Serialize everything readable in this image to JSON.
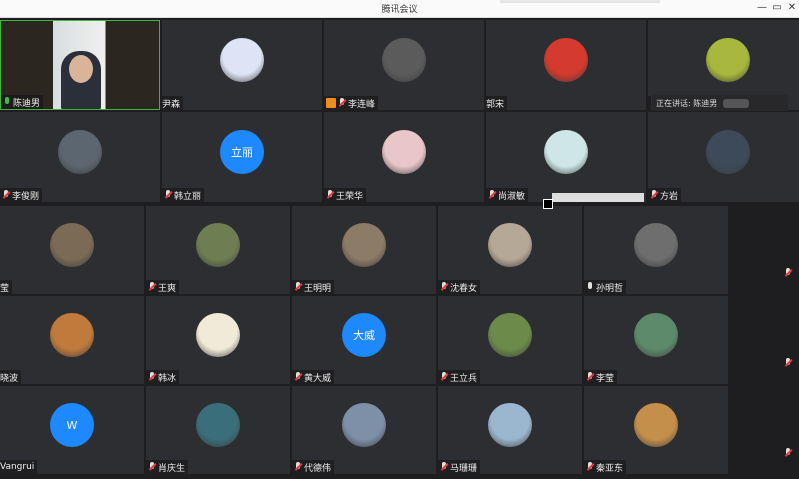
{
  "window": {
    "title": "腾讯会议",
    "controls": {
      "minimize": "—",
      "restore": "▭",
      "close": "✕"
    }
  },
  "speaking_indicator": {
    "label": "正在讲话: 陈迪男"
  },
  "participants_top": [
    {
      "name": "陈迪男",
      "mic": "on",
      "avatar": "video",
      "color": "#c8c4bc"
    },
    {
      "name": "尹森",
      "mic": "none",
      "avatar": "photo",
      "color": "#dde4f5"
    },
    {
      "name": "李连峰",
      "mic": "off",
      "avatar": "photo",
      "color": "#5b5b5b",
      "sharing": true
    },
    {
      "name": "郭宋",
      "mic": "none",
      "avatar": "photo",
      "color": "#d53a2f"
    },
    {
      "name": "",
      "mic": "none",
      "avatar": "photo",
      "color": "#a8b83c"
    },
    {
      "name": "李俊刚",
      "mic": "off",
      "avatar": "photo",
      "color": "#5c6670"
    },
    {
      "name": "韩立丽",
      "mic": "off",
      "avatar": "text",
      "avatar_text": "立丽",
      "color": "#1e88ff"
    },
    {
      "name": "王荣华",
      "mic": "off",
      "avatar": "photo",
      "color": "#e9c6c8"
    },
    {
      "name": "尚淑敏",
      "mic": "off",
      "avatar": "photo",
      "color": "#cfe6e6"
    },
    {
      "name": "方岩",
      "mic": "off",
      "avatar": "photo",
      "color": "#3d4a5a"
    }
  ],
  "participants_bottom": [
    {
      "name": "莹",
      "mic": "none",
      "avatar": "photo",
      "color": "#7b6a55"
    },
    {
      "name": "王爽",
      "mic": "off",
      "avatar": "photo",
      "color": "#6f7e52"
    },
    {
      "name": "王明明",
      "mic": "off",
      "avatar": "photo",
      "color": "#8c7b66"
    },
    {
      "name": "沈春女",
      "mic": "off",
      "avatar": "photo",
      "color": "#b6a897"
    },
    {
      "name": "孙明哲",
      "mic": "on_gray",
      "avatar": "photo",
      "color": "#6e6e6e"
    },
    {
      "name": "晓波",
      "mic": "none",
      "avatar": "photo",
      "color": "#c07a3c"
    },
    {
      "name": "韩冰",
      "mic": "off",
      "avatar": "photo",
      "color": "#f1ead8"
    },
    {
      "name": "黄大威",
      "mic": "off",
      "avatar": "text",
      "avatar_text": "大威",
      "color": "#1e88ff"
    },
    {
      "name": "王立兵",
      "mic": "off",
      "avatar": "photo",
      "color": "#6c8a4a"
    },
    {
      "name": "李莹",
      "mic": "off",
      "avatar": "photo",
      "color": "#5d8a6a"
    },
    {
      "name": "Vangrui",
      "mic": "none",
      "avatar": "text",
      "avatar_text": "W",
      "color": "#1e88ff"
    },
    {
      "name": "肖庆生",
      "mic": "off",
      "avatar": "photo",
      "color": "#3a6e7a"
    },
    {
      "name": "代德伟",
      "mic": "off",
      "avatar": "photo",
      "color": "#7e8fa8"
    },
    {
      "name": "马珊珊",
      "mic": "off",
      "avatar": "photo",
      "color": "#9bb6cf"
    },
    {
      "name": "秦亚东",
      "mic": "off",
      "avatar": "photo",
      "color": "#c48f4a"
    }
  ]
}
